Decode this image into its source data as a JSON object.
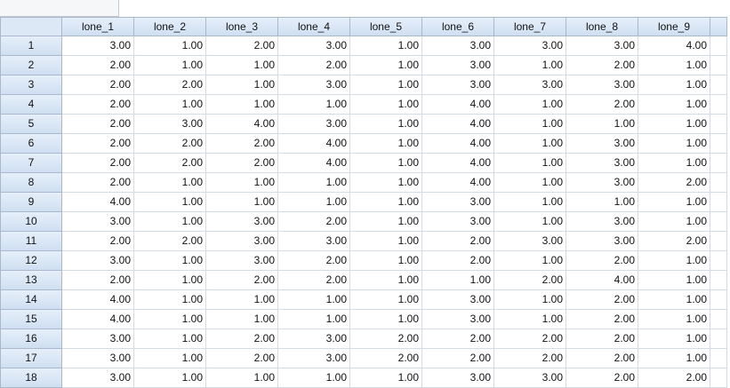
{
  "columns": [
    "lone_1",
    "lone_2",
    "lone_3",
    "lone_4",
    "lone_5",
    "lone_6",
    "lone_7",
    "lone_8",
    "lone_9"
  ],
  "rows": [
    {
      "n": "1",
      "v": [
        "3.00",
        "1.00",
        "2.00",
        "3.00",
        "1.00",
        "3.00",
        "3.00",
        "3.00",
        "4.00"
      ]
    },
    {
      "n": "2",
      "v": [
        "2.00",
        "1.00",
        "1.00",
        "2.00",
        "1.00",
        "3.00",
        "1.00",
        "2.00",
        "1.00"
      ]
    },
    {
      "n": "3",
      "v": [
        "2.00",
        "2.00",
        "1.00",
        "3.00",
        "1.00",
        "3.00",
        "3.00",
        "3.00",
        "1.00"
      ]
    },
    {
      "n": "4",
      "v": [
        "2.00",
        "1.00",
        "1.00",
        "1.00",
        "1.00",
        "4.00",
        "1.00",
        "2.00",
        "1.00"
      ]
    },
    {
      "n": "5",
      "v": [
        "2.00",
        "3.00",
        "4.00",
        "3.00",
        "1.00",
        "4.00",
        "1.00",
        "1.00",
        "1.00"
      ]
    },
    {
      "n": "6",
      "v": [
        "2.00",
        "2.00",
        "2.00",
        "4.00",
        "1.00",
        "4.00",
        "1.00",
        "3.00",
        "1.00"
      ]
    },
    {
      "n": "7",
      "v": [
        "2.00",
        "2.00",
        "2.00",
        "4.00",
        "1.00",
        "4.00",
        "1.00",
        "3.00",
        "1.00"
      ]
    },
    {
      "n": "8",
      "v": [
        "2.00",
        "1.00",
        "1.00",
        "1.00",
        "1.00",
        "4.00",
        "1.00",
        "3.00",
        "2.00"
      ]
    },
    {
      "n": "9",
      "v": [
        "4.00",
        "1.00",
        "1.00",
        "1.00",
        "1.00",
        "3.00",
        "1.00",
        "1.00",
        "1.00"
      ]
    },
    {
      "n": "10",
      "v": [
        "3.00",
        "1.00",
        "3.00",
        "2.00",
        "1.00",
        "3.00",
        "1.00",
        "3.00",
        "1.00"
      ]
    },
    {
      "n": "11",
      "v": [
        "2.00",
        "2.00",
        "3.00",
        "3.00",
        "1.00",
        "2.00",
        "3.00",
        "3.00",
        "2.00"
      ]
    },
    {
      "n": "12",
      "v": [
        "3.00",
        "1.00",
        "3.00",
        "2.00",
        "1.00",
        "2.00",
        "1.00",
        "2.00",
        "1.00"
      ]
    },
    {
      "n": "13",
      "v": [
        "2.00",
        "1.00",
        "2.00",
        "2.00",
        "1.00",
        "1.00",
        "2.00",
        "4.00",
        "1.00"
      ]
    },
    {
      "n": "14",
      "v": [
        "4.00",
        "1.00",
        "1.00",
        "1.00",
        "1.00",
        "3.00",
        "1.00",
        "2.00",
        "1.00"
      ]
    },
    {
      "n": "15",
      "v": [
        "4.00",
        "1.00",
        "1.00",
        "1.00",
        "1.00",
        "3.00",
        "1.00",
        "2.00",
        "1.00"
      ]
    },
    {
      "n": "16",
      "v": [
        "3.00",
        "1.00",
        "2.00",
        "3.00",
        "2.00",
        "2.00",
        "2.00",
        "2.00",
        "1.00"
      ]
    },
    {
      "n": "17",
      "v": [
        "3.00",
        "1.00",
        "2.00",
        "3.00",
        "2.00",
        "2.00",
        "2.00",
        "2.00",
        "1.00"
      ]
    },
    {
      "n": "18",
      "v": [
        "3.00",
        "1.00",
        "1.00",
        "1.00",
        "1.00",
        "3.00",
        "3.00",
        "2.00",
        "2.00"
      ]
    }
  ]
}
